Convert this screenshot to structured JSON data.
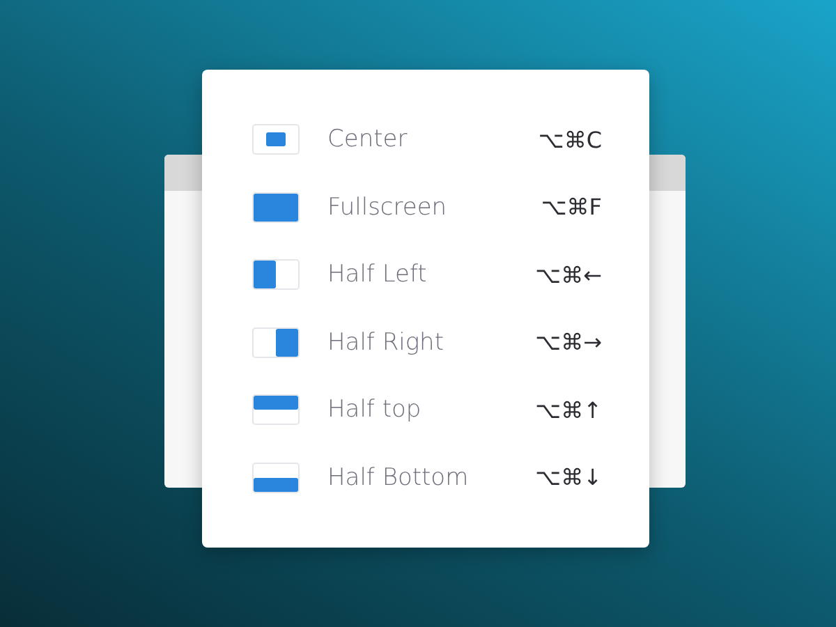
{
  "menu": {
    "items": [
      {
        "kind": "center",
        "label": "Center",
        "shortcut": "⌥⌘C"
      },
      {
        "kind": "full",
        "label": "Fullscreen",
        "shortcut": "⌥⌘F"
      },
      {
        "kind": "left",
        "label": "Half Left",
        "shortcut": "⌥⌘←"
      },
      {
        "kind": "right",
        "label": "Half Right",
        "shortcut": "⌥⌘→"
      },
      {
        "kind": "top",
        "label": "Half top",
        "shortcut": "⌥⌘↑"
      },
      {
        "kind": "bottom",
        "label": "Half Bottom",
        "shortcut": "⌥⌘↓"
      }
    ]
  }
}
